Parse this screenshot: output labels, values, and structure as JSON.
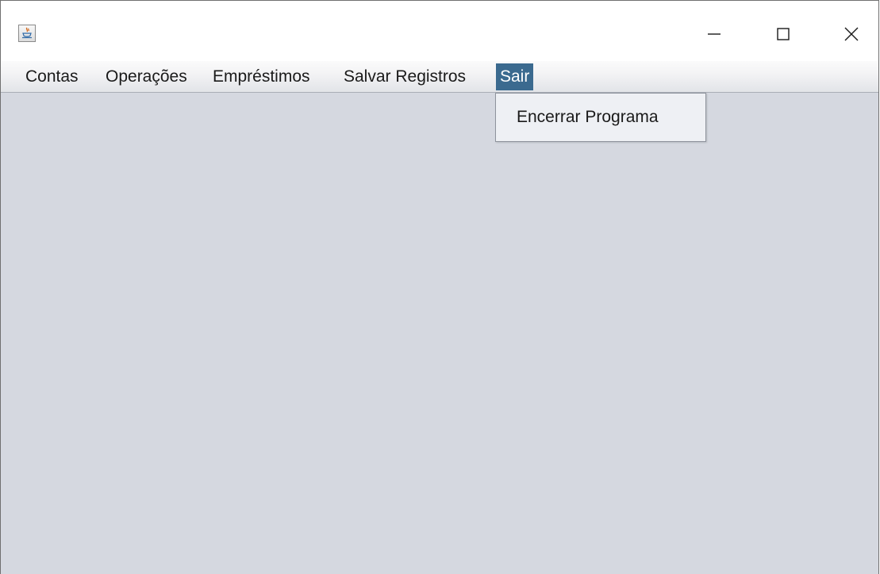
{
  "window": {
    "title": "",
    "controls": {
      "minimize_icon": "minimize-icon",
      "maximize_icon": "maximize-icon",
      "close_icon": "close-icon"
    }
  },
  "menubar": {
    "items": [
      {
        "label": "Contas"
      },
      {
        "label": "Operações"
      },
      {
        "label": "Empréstimos"
      },
      {
        "label": "Salvar Registros"
      },
      {
        "label": "Sair",
        "selected": true
      }
    ]
  },
  "dropdown": {
    "parent": "Sair",
    "items": [
      {
        "label": "Encerrar Programa"
      }
    ]
  },
  "colors": {
    "menu_selected_bg": "#3b6a8f",
    "content_bg": "#d5d8e0",
    "dropdown_bg": "#eef0f4"
  }
}
